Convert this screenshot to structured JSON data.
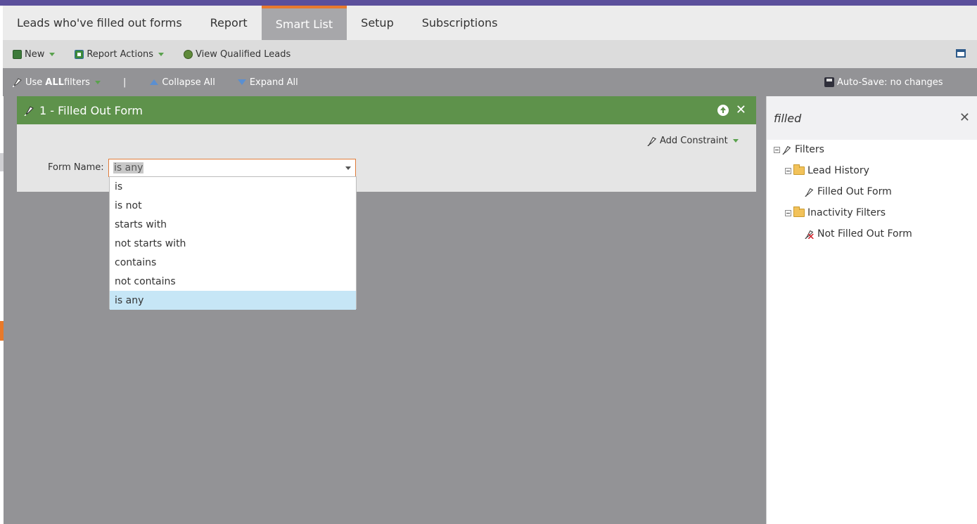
{
  "tabs": [
    {
      "label": "Leads who've filled out forms",
      "active": false
    },
    {
      "label": "Report",
      "active": false
    },
    {
      "label": "Smart List",
      "active": true
    },
    {
      "label": "Setup",
      "active": false
    },
    {
      "label": "Subscriptions",
      "active": false
    }
  ],
  "toolbar": {
    "new_label": "New",
    "report_actions_label": "Report Actions",
    "view_qualified_label": "View Qualified Leads"
  },
  "filterbar": {
    "use_prefix": "Use ",
    "use_bold": "ALL",
    "use_suffix": " filters",
    "separator": "|",
    "collapse_label": "Collapse All",
    "expand_label": "Expand All",
    "autosave_label": "Auto-Save: no changes"
  },
  "filter_card": {
    "title": "1 - Filled Out Form",
    "add_constraint_label": "Add Constraint",
    "form_name_label": "Form Name:",
    "operator_value": "is any"
  },
  "dropdown": {
    "options": [
      "is",
      "is not",
      "starts with",
      "not starts with",
      "contains",
      "not contains",
      "is any"
    ],
    "selected": "is any"
  },
  "sidebar": {
    "search_value": "filled",
    "tree": {
      "root": "Filters",
      "groups": [
        {
          "label": "Lead History",
          "items": [
            "Filled Out Form"
          ]
        },
        {
          "label": "Inactivity Filters",
          "items": [
            "Not Filled Out Form"
          ]
        }
      ]
    }
  },
  "colors": {
    "accent_purple": "#5b4f9b",
    "tab_active_underline": "#e9792c",
    "card_header_green": "#5e924b",
    "selected_option": "#c6e6f6",
    "workspace_gray": "#939396"
  }
}
